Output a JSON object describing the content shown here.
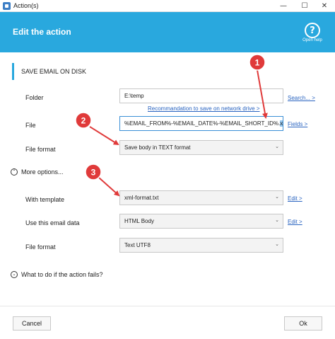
{
  "window": {
    "title": "Action(s)",
    "minimize_glyph": "—",
    "maximize_glyph": "☐",
    "close_glyph": "✕"
  },
  "header": {
    "title": "Edit the action",
    "help_glyph": "?",
    "help_label": "Open help"
  },
  "section": {
    "title": "SAVE EMAIL ON DISK"
  },
  "folder": {
    "label": "Folder",
    "value": "E:\\temp",
    "browse_link": "Search... >",
    "recommendation_link": "Recommandation to save on network drive >"
  },
  "file": {
    "label": "File",
    "value_main": "%EMAIL_FROM%-%EMAIL_DATE%-%EMAIL_SHORT_ID%.",
    "value_selected": "xml",
    "fields_link": "Fields >"
  },
  "file_format": {
    "label": "File format",
    "value": "Save body in TEXT format"
  },
  "more_options": {
    "label": "More options...",
    "glyph": "⌃"
  },
  "template": {
    "label": "With template",
    "value": "xml-format.txt",
    "edit_link": "Edit >"
  },
  "email_data": {
    "label": "Use this email data",
    "value": "HTML Body",
    "edit_link": "Edit >"
  },
  "encoding": {
    "label": "File format",
    "value": "Text UTF8"
  },
  "on_fail": {
    "label": "What to do if the action fails?",
    "glyph": "⌄"
  },
  "dropdown_icon": "chevron-down-icon",
  "dropdown_glyph": "⌄",
  "buttons": {
    "cancel": "Cancel",
    "ok": "Ok"
  },
  "annotations": [
    {
      "number": "1",
      "color": "#e03a3a"
    },
    {
      "number": "2",
      "color": "#e03a3a"
    },
    {
      "number": "3",
      "color": "#e03a3a"
    }
  ],
  "colors": {
    "accent": "#29a8de",
    "link": "#2a64c0",
    "annotation": "#e03a3a",
    "selection": "#99c9f0"
  }
}
